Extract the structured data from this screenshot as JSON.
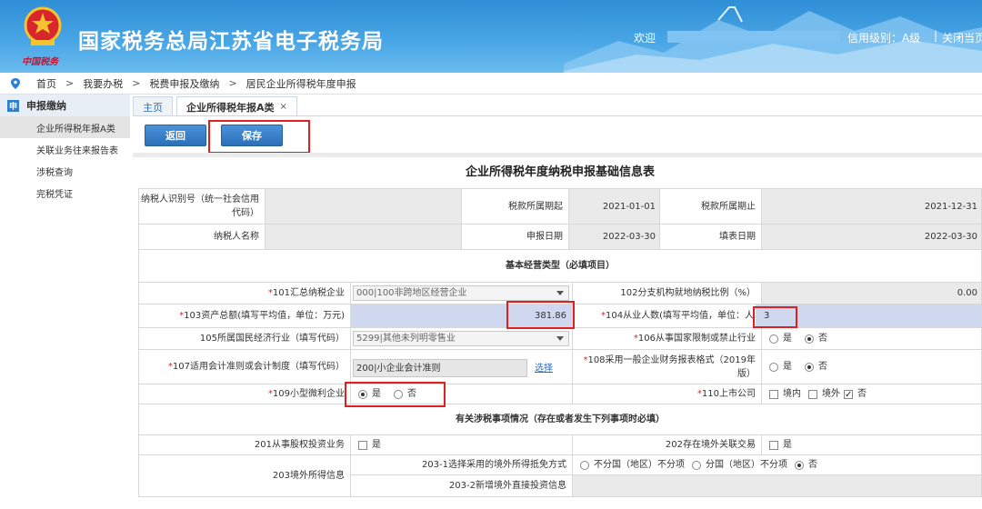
{
  "header": {
    "site_title": "国家税务总局江苏省电子税务局",
    "slogan": "中国税务",
    "welcome": "欢迎",
    "credit_level": "信用级别：A级",
    "separator": "|",
    "close_link": "关闭当页"
  },
  "breadcrumb": [
    "首页",
    "我要办税",
    "税费申报及缴纳",
    "居民企业所得税年度申报"
  ],
  "sidebar": {
    "group_icon": "申",
    "group_label": "申报缴纳",
    "items": [
      "企业所得税年报A类",
      "关联业务往来报告表",
      "涉税查询",
      "完税凭证"
    ]
  },
  "tabs": [
    {
      "label": "主页"
    },
    {
      "label": "企业所得税年报A类",
      "close": "×"
    }
  ],
  "buttons": {
    "back": "返回",
    "save": "保存"
  },
  "form": {
    "title": "企业所得税年度纳税申报基础信息表",
    "taxpayer_id_label": "纳税人识别号（统一社会信用代码）",
    "taxpayer_name_label": "纳税人名称",
    "period_start_label": "税款所属期起",
    "period_start": "2021-01-01",
    "period_end_label": "税款所属期止",
    "period_end": "2021-12-31",
    "filing_date_label": "申报日期",
    "filing_date": "2022-03-30",
    "fill_date_label": "填表日期",
    "fill_date": "2022-03-30",
    "section1": "基本经营类型（必填项目）",
    "f101_label": "101汇总纳税企业",
    "f101_value": "000|100非跨地区经营企业",
    "f102_label": "102分支机构就地纳税比例（%）",
    "f102_value": "0.00",
    "f103_label": "103资产总额(填写平均值，单位：万元)",
    "f103_value": "381.86",
    "f104_label": "104从业人数(填写平均值，单位：人",
    "f104_value": "3",
    "f105_label": "105所属国民经济行业（填写代码）",
    "f105_value": "5299|其他未列明零售业",
    "f106_label": "106从事国家限制或禁止行业",
    "f107_label": "107适用会计准则或会计制度（填写代码）",
    "f107_value": "200|小企业会计准则",
    "f107_link": "选择",
    "f108_label": "108采用一般企业财务报表格式（2019年版）",
    "f109_label": "109小型微利企业",
    "f110_label": "110上市公司",
    "yes": "是",
    "no": "否",
    "domestic": "境内",
    "overseas": "境外",
    "section2": "有关涉税事项情况（存在或者发生下列事项时必填）",
    "f201_label": "201从事股权投资业务",
    "f202_label": "202存在境外关联交易",
    "f203_label": "203境外所得信息",
    "f203_1_label": "203-1选择采用的境外所得抵免方式",
    "f203_1_opt1": "不分国（地区）不分项",
    "f203_1_opt2": "分国（地区）不分项",
    "f203_2_label": "203-2新增境外直接投资信息"
  },
  "colors": {
    "brand_blue": "#2f8fd6",
    "highlight_red": "#e02020"
  }
}
